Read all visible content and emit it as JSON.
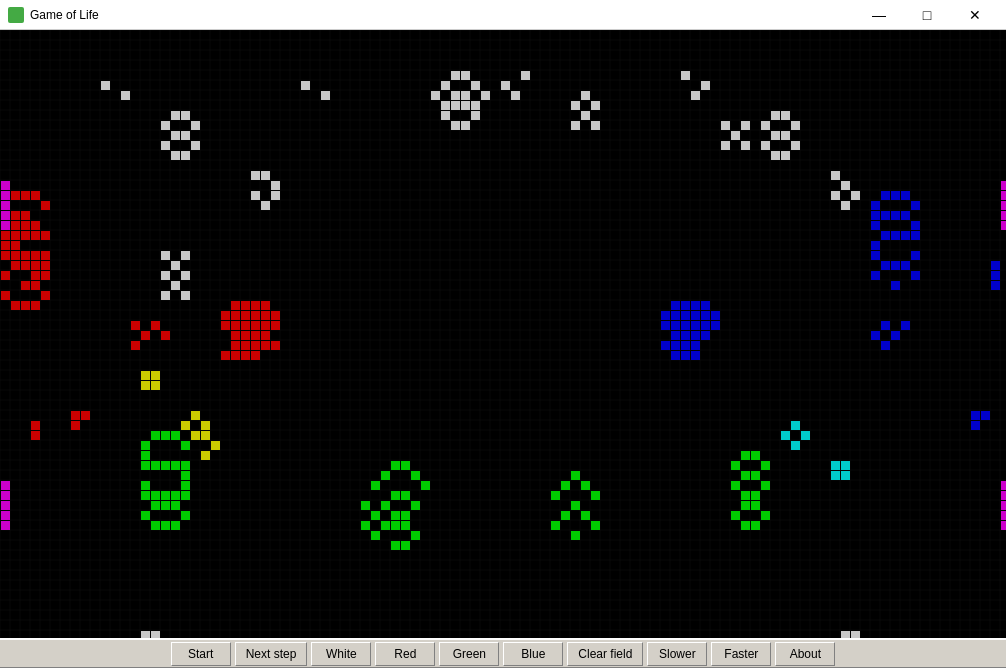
{
  "titleBar": {
    "title": "Game of Life",
    "minimizeLabel": "—",
    "maximizeLabel": "□",
    "closeLabel": "✕"
  },
  "toolbar": {
    "buttons": [
      {
        "id": "start",
        "label": "Start"
      },
      {
        "id": "next-step",
        "label": "Next step"
      },
      {
        "id": "white",
        "label": "White"
      },
      {
        "id": "red",
        "label": "Red"
      },
      {
        "id": "green",
        "label": "Green"
      },
      {
        "id": "blue",
        "label": "Blue"
      },
      {
        "id": "clear-field",
        "label": "Clear field"
      },
      {
        "id": "slower",
        "label": "Slower"
      },
      {
        "id": "faster",
        "label": "Faster"
      },
      {
        "id": "about",
        "label": "About"
      }
    ]
  },
  "colors": {
    "background": "#000000",
    "gridLine": "#1a1a1a",
    "white": "#c8c8c8",
    "red": "#cc0000",
    "green": "#00cc00",
    "blue": "#0000cc",
    "yellow": "#cccc00",
    "cyan": "#00cccc",
    "magenta": "#cc00cc"
  }
}
